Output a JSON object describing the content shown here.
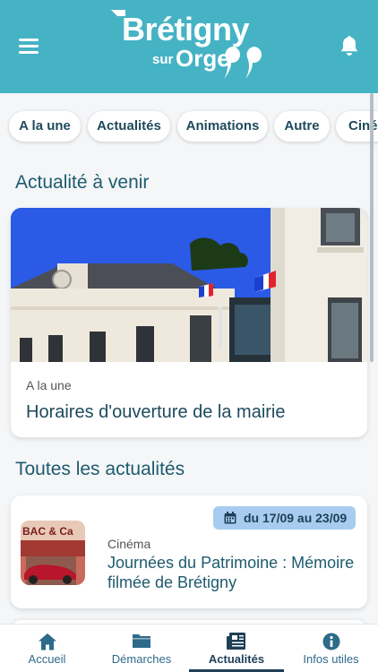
{
  "header": {
    "logo_main": "Brétigny",
    "logo_sur": "sur",
    "logo_orge": "Orge",
    "menu_icon": "hamburger-menu-icon",
    "bell_icon": "bell-icon"
  },
  "categories": [
    {
      "label": "A la une",
      "active": true
    },
    {
      "label": "Actualités",
      "active": false
    },
    {
      "label": "Animations",
      "active": false
    },
    {
      "label": "Autre",
      "active": false
    },
    {
      "label": "Ciné",
      "active": false
    }
  ],
  "upcoming": {
    "section_title": "Actualité à venir",
    "card": {
      "category": "A la une",
      "title": "Horaires d'ouverture de la mairie"
    }
  },
  "all_news": {
    "section_title": "Toutes les actualités",
    "items": [
      {
        "date": "du 17/09 au 23/09",
        "category": "Cinéma",
        "title": "Journées du Patrimoine : Mémoire filmée de Brétigny"
      }
    ]
  },
  "tabbar": {
    "tabs": [
      {
        "label": "Accueil",
        "icon": "home-icon",
        "active": false
      },
      {
        "label": "Démarches",
        "icon": "folder-icon",
        "active": false
      },
      {
        "label": "Actualités",
        "icon": "newspaper-icon",
        "active": true
      },
      {
        "label": "Infos utiles",
        "icon": "info-icon",
        "active": false
      }
    ]
  },
  "colors": {
    "header": "#45b3c4",
    "primary_text": "#1e4a5c",
    "date_badge": "#a7ccef"
  }
}
